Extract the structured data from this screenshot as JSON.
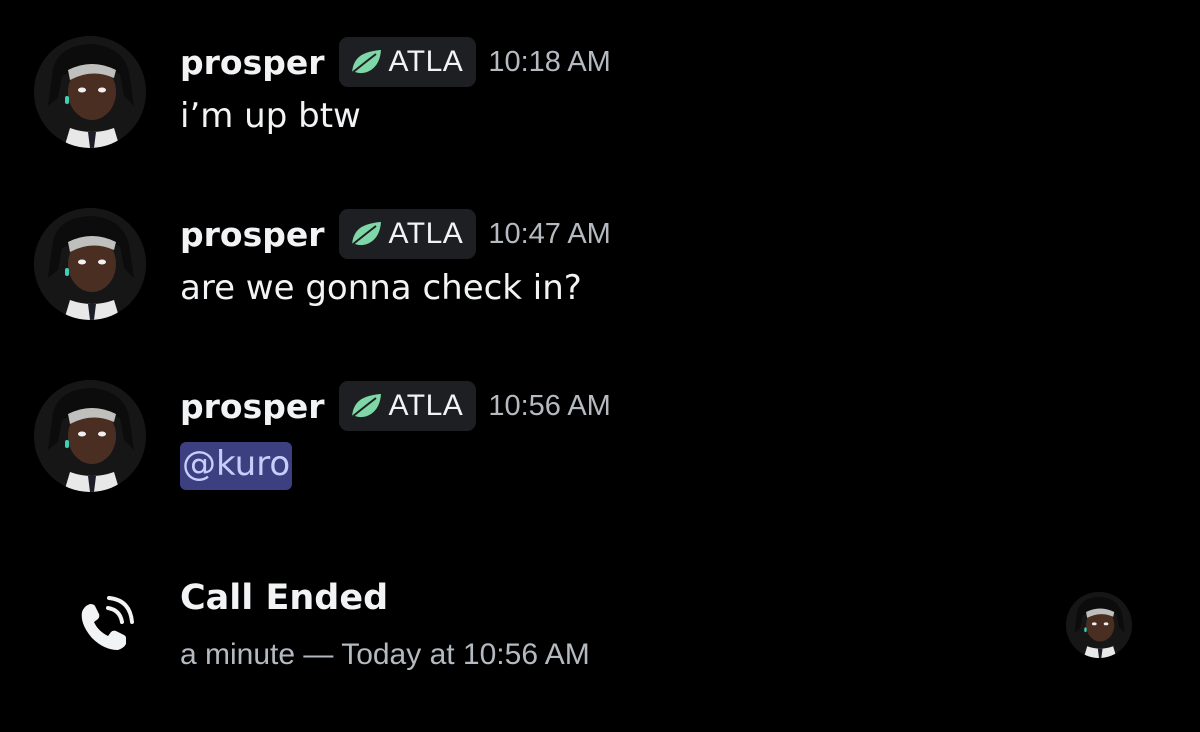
{
  "messages": [
    {
      "author": "prosper",
      "tag": "ATLA",
      "time": "10:18 AM",
      "text": "i’m up btw",
      "avatar_icon": "character-avatar-icon"
    },
    {
      "author": "prosper",
      "tag": "ATLA",
      "time": "10:47 AM",
      "text": "are we gonna check in?",
      "avatar_icon": "character-avatar-icon"
    },
    {
      "author": "prosper",
      "tag": "ATLA",
      "time": "10:56 AM",
      "mention": "@kuro",
      "avatar_icon": "character-avatar-icon"
    }
  ],
  "call": {
    "title": "Call Ended",
    "meta": "a minute — Today at 10:56 AM",
    "icon": "phone-icon"
  },
  "colors": {
    "background": "#000000",
    "tag_background": "#1e1f22",
    "tag_leaf": "#7fd6a6",
    "mention_background": "#3c4080",
    "timestamp": "#b5bac1"
  }
}
